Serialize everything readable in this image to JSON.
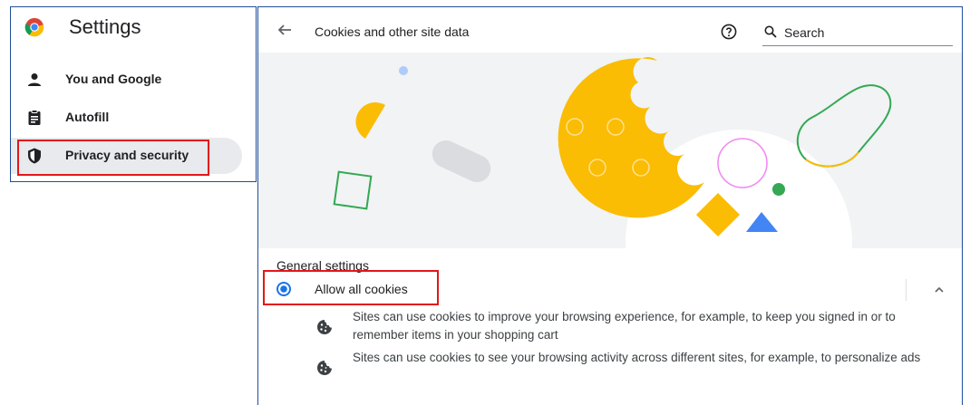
{
  "sidebar": {
    "title": "Settings",
    "items": [
      {
        "label": "You and Google",
        "icon": "person-icon"
      },
      {
        "label": "Autofill",
        "icon": "clipboard-icon"
      },
      {
        "label": "Privacy and security",
        "icon": "shield-icon",
        "active": true
      }
    ]
  },
  "header": {
    "title": "Cookies and other site data",
    "search_placeholder": "Search"
  },
  "general": {
    "section_title": "General settings",
    "option_label": "Allow all cookies",
    "option_selected": true,
    "descriptions": [
      "Sites can use cookies to improve your browsing experience, for example, to keep you signed in or to remember items in your shopping cart",
      "Sites can use cookies to see your browsing activity across different sites, for example, to personalize ads"
    ]
  },
  "colors": {
    "accent": "#1a73e8",
    "highlight": "#e3161b",
    "cookie_yellow": "#fbbc04",
    "green": "#34a853",
    "pink": "#f28bf0"
  }
}
